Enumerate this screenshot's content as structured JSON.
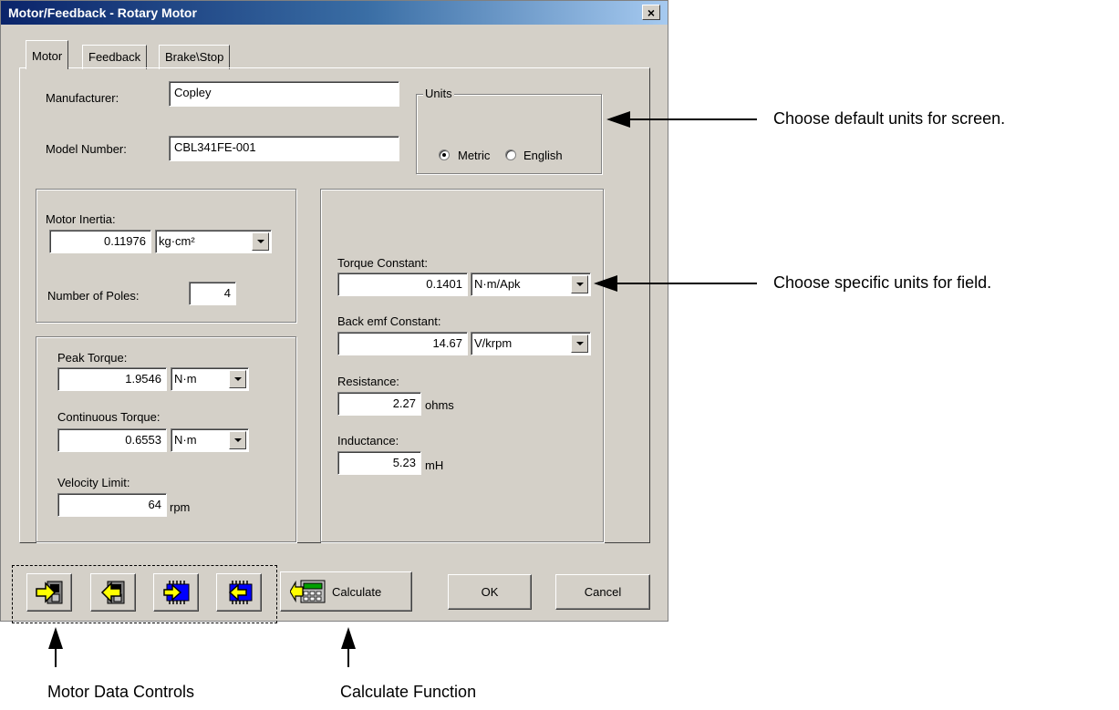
{
  "window": {
    "title": "Motor/Feedback - Rotary Motor",
    "close_glyph": "×"
  },
  "tabs": [
    {
      "label": "Motor"
    },
    {
      "label": "Feedback"
    },
    {
      "label": "Brake\\Stop"
    }
  ],
  "motor": {
    "manufacturer_label": "Manufacturer:",
    "manufacturer_value": "Copley",
    "model_label": "Model Number:",
    "model_value": "CBL341FE-001",
    "units": {
      "legend": "Units",
      "metric": "Metric",
      "english": "English",
      "selected": "Metric"
    },
    "inertia": {
      "label": "Motor Inertia:",
      "value": "0.11976",
      "unit": "kg·cm²"
    },
    "poles": {
      "label": "Number of Poles:",
      "value": "4"
    },
    "peak_torque": {
      "label": "Peak Torque:",
      "value": "1.9546",
      "unit": "N·m"
    },
    "continuous_torque": {
      "label": "Continuous Torque:",
      "value": "0.6553",
      "unit": "N·m"
    },
    "velocity_limit": {
      "label": "Velocity Limit:",
      "value": "64",
      "unit": "rpm"
    },
    "torque_constant": {
      "label": "Torque Constant:",
      "value": "0.1401",
      "unit": "N·m/Apk"
    },
    "back_emf": {
      "label": "Back emf Constant:",
      "value": "14.67",
      "unit": "V/krpm"
    },
    "resistance": {
      "label": "Resistance:",
      "value": "2.27",
      "unit": "ohms"
    },
    "inductance": {
      "label": "Inductance:",
      "value": "5.23",
      "unit": "mH"
    }
  },
  "buttons": {
    "calculate": "Calculate",
    "ok": "OK",
    "cancel": "Cancel"
  },
  "icons": [
    "open-file-icon",
    "save-file-icon",
    "read-from-amp-icon",
    "write-to-amp-icon",
    "calculator-icon"
  ],
  "annotations": {
    "default_units": "Choose default units for screen.",
    "specific_units": "Choose specific units for field.",
    "motor_data_controls": "Motor Data Controls",
    "calculate_function": "Calculate Function"
  },
  "colors": {
    "title_bar": "#0a246a",
    "dialog_face": "#d4d0c8",
    "icon_yellow": "#ffff00",
    "icon_blue": "#0000ff"
  }
}
